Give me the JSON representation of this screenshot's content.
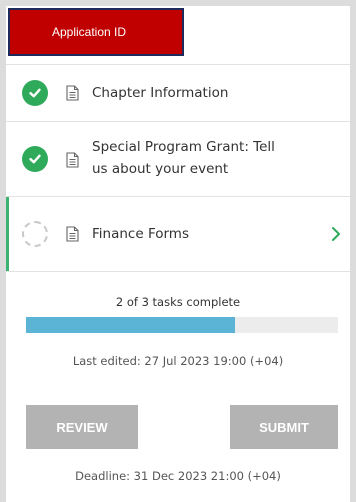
{
  "header": {
    "application_id_label": "Application ID"
  },
  "tasks": [
    {
      "label_line1": "Chapter Information",
      "label_line2": "",
      "status": "complete",
      "icon": "document-icon"
    },
    {
      "label_line1": "Special Program Grant: Tell",
      "label_line2": "us about your event",
      "status": "complete",
      "icon": "document-icon"
    },
    {
      "label_line1": "Finance Forms",
      "label_line2": "",
      "status": "pending",
      "icon": "document-icon"
    }
  ],
  "progress": {
    "text": "2 of 3 tasks complete",
    "completed": 2,
    "total": 3,
    "fill_fraction": 0.67
  },
  "last_edited": "Last edited: 27 Jul 2023 19:00 (+04)",
  "buttons": {
    "review": "REVIEW",
    "submit": "SUBMIT"
  },
  "deadline": "Deadline: 31 Dec 2023 21:00 (+04)",
  "colors": {
    "brand_red": "#c00000",
    "complete_green": "#2eaa5a",
    "progress_blue": "#5bb4d6",
    "button_gray": "#b3b3b3"
  }
}
